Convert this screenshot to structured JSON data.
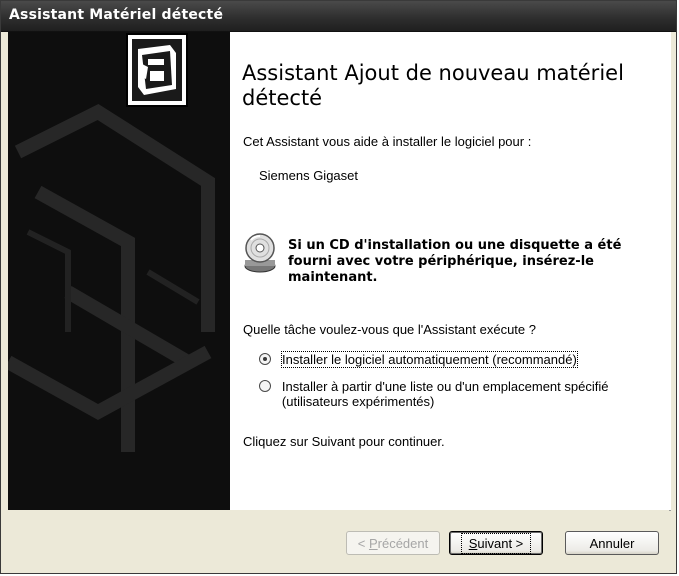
{
  "window": {
    "title": "Assistant Matériel détecté"
  },
  "wizard": {
    "heading": "Assistant Ajout de nouveau matériel détecté",
    "intro": "Cet Assistant vous aide à installer le logiciel pour :",
    "device_name": "Siemens Gigaset",
    "cd_message": "Si un CD d'installation ou une disquette a été fourni avec votre périphérique, insérez-le maintenant.",
    "question": "Quelle tâche voulez-vous que l'Assistant exécute ?",
    "options": [
      {
        "label": "Installer le logiciel automatiquement (recommandé)",
        "checked": true
      },
      {
        "label": "Installer à partir d'une liste ou d'un emplacement spécifié (utilisateurs expérimentés)",
        "checked": false
      }
    ],
    "continue_hint": "Cliquez sur Suivant pour continuer."
  },
  "buttons": {
    "back": {
      "prefix": "< ",
      "mnemonic": "P",
      "rest": "récédent",
      "enabled": false
    },
    "next": {
      "mnemonic": "S",
      "rest": "uivant >",
      "enabled": true
    },
    "cancel": {
      "label": "Annuler",
      "enabled": true
    }
  },
  "icons": {
    "hardware": "hardware-wizard-icon",
    "cd": "cd-disc-icon",
    "sidebar_art": "wizard-banner-art"
  }
}
